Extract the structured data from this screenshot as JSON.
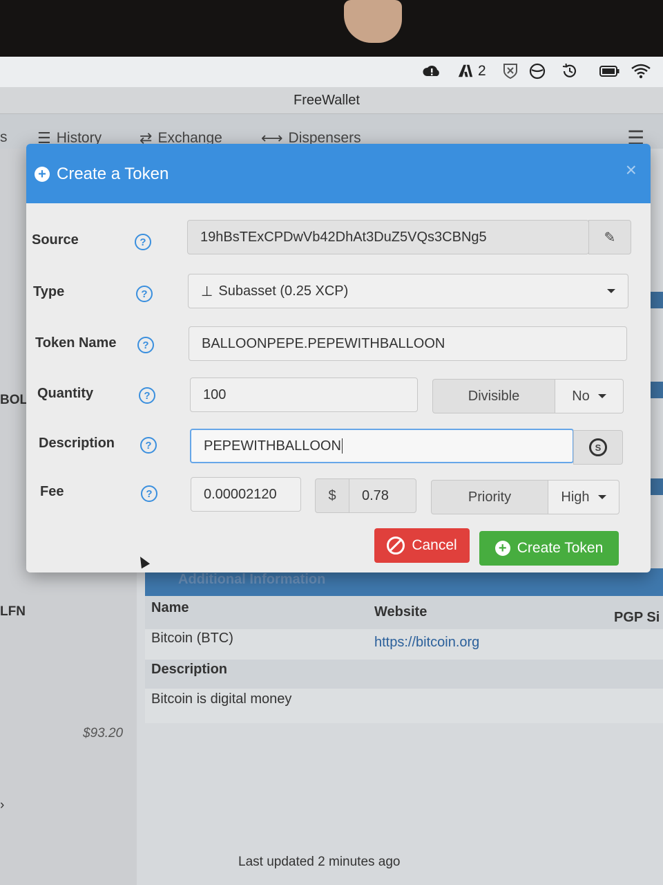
{
  "menubar": {
    "icons": [
      "alert-cloud-icon",
      "adobe-icon",
      "shield-x-icon",
      "circle-slash-icon",
      "time-machine-icon",
      "battery-icon",
      "wifi-icon"
    ],
    "adobe_count": "2"
  },
  "window": {
    "title": "FreeWallet"
  },
  "nav": {
    "cut_label": "s",
    "items": [
      {
        "label": "History",
        "icon": "list-icon"
      },
      {
        "label": "Exchange",
        "icon": "exchange-icon"
      },
      {
        "label": "Dispensers",
        "icon": "arrows-horizontal-icon"
      }
    ]
  },
  "background": {
    "side_label_1": "BOL",
    "side_label_2": "LFN",
    "side_label_3": "›",
    "price": "$93.20",
    "info_title": "Additional Information",
    "headers": {
      "name": "Name",
      "website": "Website",
      "pgp": "PGP Si"
    },
    "row": {
      "name": "Bitcoin (BTC)",
      "website": "https://bitcoin.org"
    },
    "desc_header": "Description",
    "desc_value": "Bitcoin is digital money",
    "footer": "Last updated 2 minutes ago"
  },
  "modal": {
    "title": "Create a Token",
    "close": "×",
    "fields": {
      "source": {
        "label": "Source",
        "value": "19hBsTExCPDwVb42DhAt3DuZ5VQs3CBNg5"
      },
      "type": {
        "label": "Type",
        "value": "Subasset (0.25 XCP)"
      },
      "token_name": {
        "label": "Token Name",
        "value": "BALLOONPEPE.PEPEWITHBALLOON"
      },
      "quantity": {
        "label": "Quantity",
        "value": "100",
        "divisible_label": "Divisible",
        "divisible_value": "No"
      },
      "description": {
        "label": "Description",
        "value": "PEPEWITHBALLOON"
      },
      "fee": {
        "label": "Fee",
        "btc": "0.00002120",
        "currency": "$",
        "usd": "0.78",
        "priority_label": "Priority",
        "priority_value": "High"
      }
    },
    "help": "?",
    "cancel": "Cancel",
    "create": "Create Token"
  },
  "colors": {
    "header_blue": "#3a8fde",
    "cancel_red": "#e0403c",
    "create_green": "#47ad3f"
  }
}
